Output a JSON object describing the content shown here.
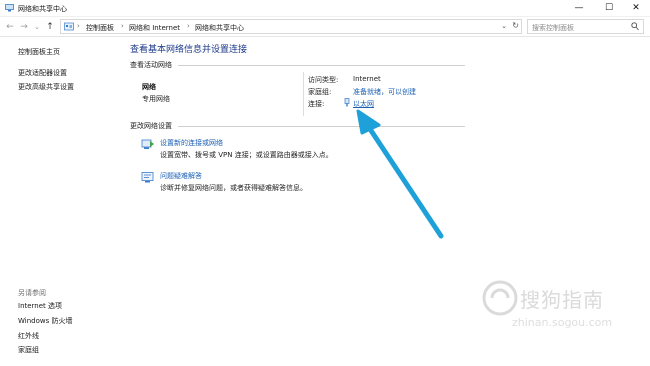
{
  "window": {
    "title": "网络和共享中心",
    "minimize_glyph": "—",
    "maximize_glyph": "☐",
    "close_glyph": "✕"
  },
  "address_bar": {
    "crumbs": [
      "控制面板",
      "网络和 Internet",
      "网络和共享中心"
    ],
    "separator": "›",
    "dropdown_glyph": "⌄",
    "refresh_glyph": "↻"
  },
  "search": {
    "placeholder": "搜索控制面板"
  },
  "nav_buttons": {
    "back": "←",
    "forward": "→",
    "recent": "⌄",
    "up": "↑"
  },
  "left_nav": {
    "items": [
      "控制面板主页",
      "更改适配器设置",
      "更改高级共享设置"
    ],
    "see_also_label": "另请参阅",
    "see_also": [
      "Internet 选项",
      "Windows 防火墙",
      "红外线",
      "家庭组"
    ]
  },
  "main": {
    "title": "查看基本网络信息并设置连接",
    "active_networks_label": "查看活动网络",
    "network_name": "网络",
    "network_type": "专用网络",
    "access_type_label": "访问类型:",
    "access_type_value": "Internet",
    "homegroup_label": "家庭组:",
    "homegroup_value": "准备就绪，可以创建",
    "connections_label": "连接:",
    "connections_value": "以太网",
    "change_settings_label": "更改网络设置",
    "tasks": [
      {
        "link": "设置新的连接或网络",
        "desc": "设置宽带、拨号或 VPN 连接；或设置路由器或接入点。"
      },
      {
        "link": "问题疑难解答",
        "desc": "诊断并修复网络问题，或者获得疑难解答信息。"
      }
    ]
  },
  "watermark": {
    "text": "搜狗指南",
    "sub": "zhinan.sogou.com"
  },
  "colors": {
    "accent_link": "#1a5fb4",
    "title_blue": "#1e3a8a",
    "arrow": "#1ea0d8"
  }
}
